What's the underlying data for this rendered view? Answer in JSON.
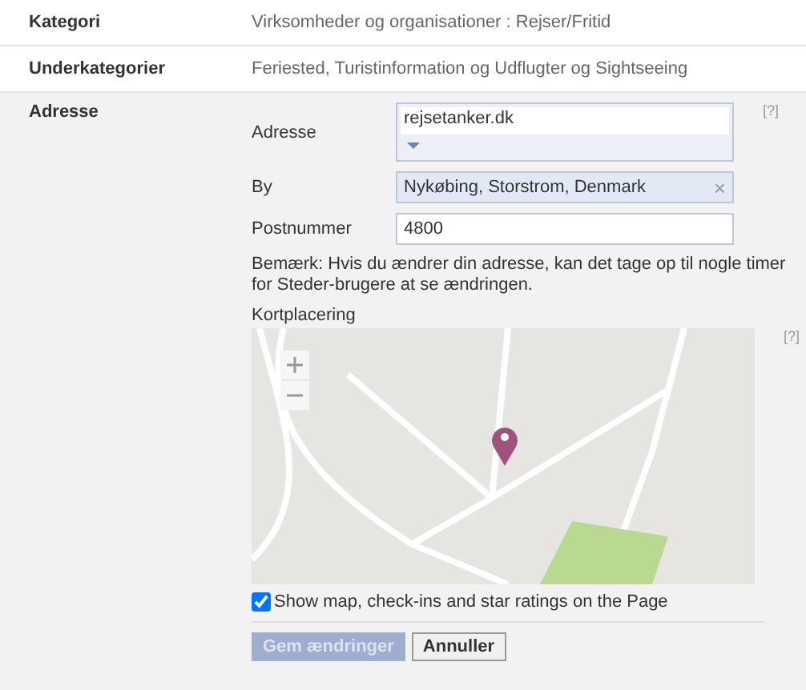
{
  "rows": [
    {
      "label": "Kategori",
      "value": "Virksomheder og organisationer : Rejser/Fritid"
    },
    {
      "label": "Underkategorier",
      "value": "Feriested, Turistinformation og Udflugter og Sightseeing"
    }
  ],
  "address_section": {
    "label": "Adresse",
    "fields": [
      {
        "kind": "tokens",
        "label": "Adresse",
        "value": "rejsetanker.dk",
        "help": "[?]"
      },
      {
        "kind": "token",
        "label": "By",
        "value": "Nykøbing, Storstrom, Denmark",
        "clear": "×"
      },
      {
        "kind": "text",
        "label": "Postnummer",
        "value": "4800"
      }
    ],
    "note": "Bemærk: Hvis du ændrer din adresse, kan det tage op til nogle timer for Steder-brugere at se ændringen.",
    "map": {
      "label": "Kortplacering",
      "help": "[?]"
    },
    "show_map": {
      "label": "Show map, check-ins and star ratings on the Page",
      "checked": true
    },
    "buttons": [
      {
        "label": "Gem ændringer",
        "disabled": true
      },
      {
        "label": "Annuller",
        "disabled": false
      }
    ]
  }
}
